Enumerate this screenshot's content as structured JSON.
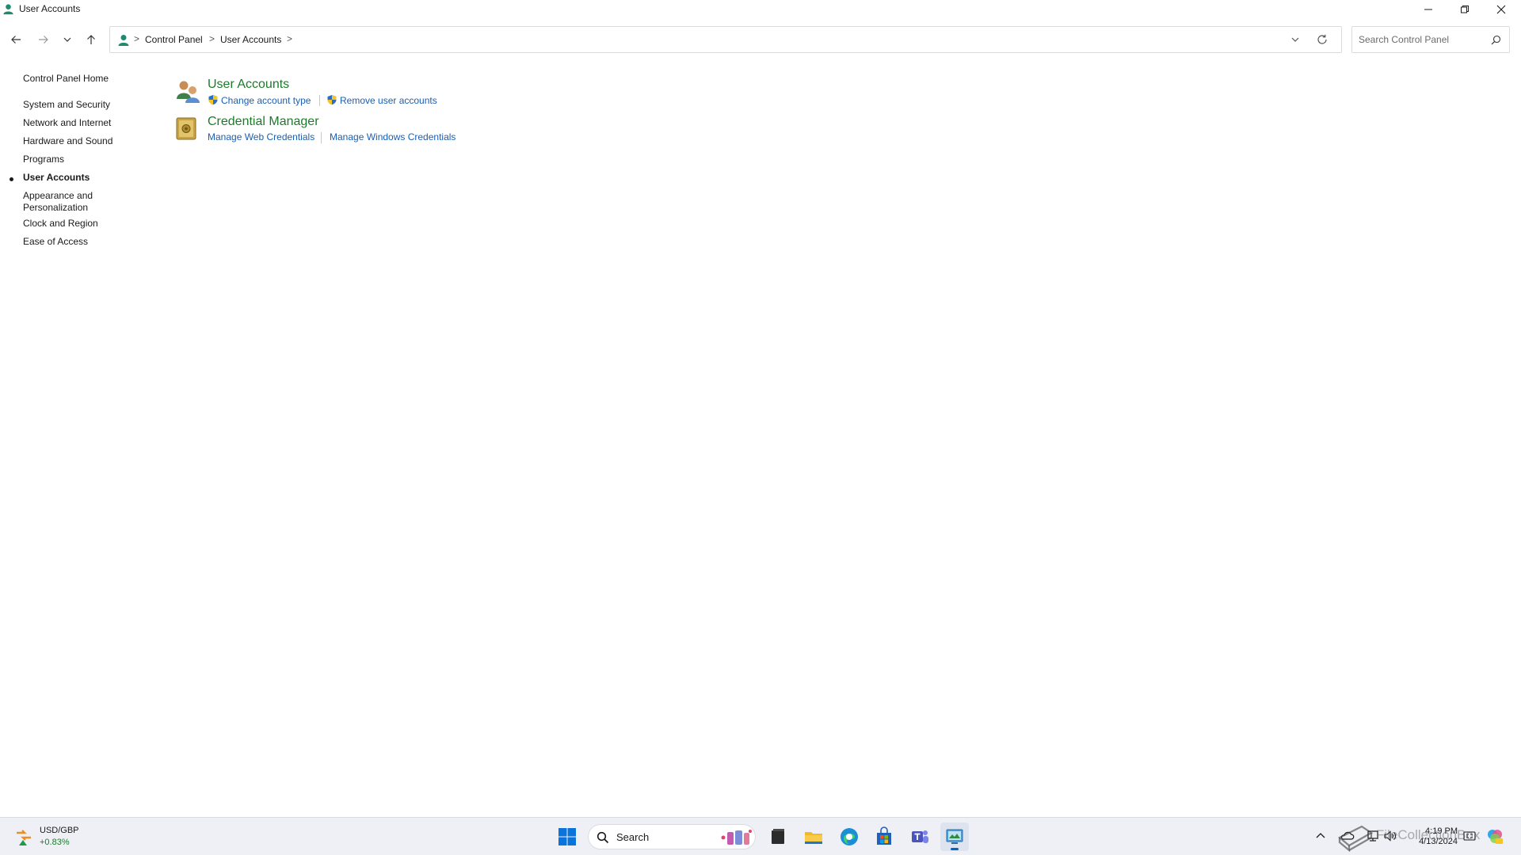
{
  "window": {
    "title": "User Accounts",
    "icon": "user-accounts-icon"
  },
  "caption": {
    "minimize_icon": "minimize-icon",
    "restore_icon": "restore-icon",
    "close_icon": "close-icon"
  },
  "address_bar": {
    "breadcrumbs": [
      "Control Panel",
      "User Accounts"
    ],
    "separator": ">"
  },
  "search": {
    "placeholder": "Search Control Panel"
  },
  "left_nav": {
    "home": "Control Panel Home",
    "items": [
      {
        "label": "System and Security"
      },
      {
        "label": "Network and Internet"
      },
      {
        "label": "Hardware and Sound"
      },
      {
        "label": "Programs"
      },
      {
        "label": "User Accounts",
        "active": true
      },
      {
        "label": "Appearance and"
      },
      {
        "label": "Personalization"
      },
      {
        "label": "Clock and Region"
      },
      {
        "label": "Ease of Access"
      }
    ]
  },
  "categories": [
    {
      "title": "User Accounts",
      "icon": "user-accounts-category-icon",
      "tasks": [
        {
          "label": "Change account type",
          "shield": true
        },
        {
          "label": "Remove user accounts",
          "shield": true
        }
      ]
    },
    {
      "title": "Credential Manager",
      "icon": "credential-manager-icon",
      "tasks": [
        {
          "label": "Manage Web Credentials",
          "shield": false
        },
        {
          "label": "Manage Windows Credentials",
          "shield": false
        }
      ]
    }
  ],
  "taskbar": {
    "widget": {
      "title": "USD/GBP",
      "change": "+0.83%",
      "icon": "currency-widget-icon"
    },
    "search_label": "Search",
    "apps": [
      "start-icon",
      "file-manager-icon",
      "file-explorer-icon",
      "edge-icon",
      "store-icon",
      "teams-icon",
      "control-panel-icon"
    ],
    "clock": {
      "time": "4:19 PM",
      "date": "4/13/2024"
    },
    "watermark": "FileCollectionBox"
  },
  "colors": {
    "category_title": "#1e7a2b",
    "task_link": "#1a5fb4",
    "taskbar_bg": "#eef0f6",
    "accent": "#0067c0"
  }
}
